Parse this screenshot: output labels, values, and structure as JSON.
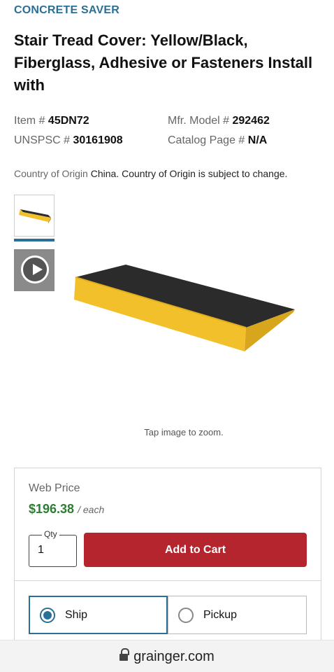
{
  "brand": "CONCRETE SAVER",
  "product": {
    "title": "Stair Tread Cover: Yellow/Black, Fiberglass, Adhesive or Fasteners Install with"
  },
  "specs": {
    "item_label": "Item #",
    "item_value": "45DN72",
    "mfr_label": "Mfr. Model #",
    "mfr_value": "292462",
    "unspsc_label": "UNSPSC #",
    "unspsc_value": "30161908",
    "catalog_label": "Catalog Page #",
    "catalog_value": "N/A"
  },
  "origin": {
    "label": "Country of Origin",
    "value": "China. Country of Origin is subject to change."
  },
  "gallery": {
    "zoom_hint": "Tap image to zoom.",
    "thumbnails": [
      "stair-tread-image",
      "play-video"
    ]
  },
  "buy": {
    "web_price_label": "Web Price",
    "price": "$196.38",
    "unit": "/ each",
    "qty_label": "Qty",
    "qty_value": "1",
    "add_to_cart": "Add to Cart",
    "fulfillment": {
      "ship_label": "Ship",
      "pickup_label": "Pickup",
      "selected": "Ship"
    }
  },
  "browser": {
    "url": "grainger.com"
  },
  "colors": {
    "brand_blue": "#2a6f97",
    "price_green": "#2e7d32",
    "cart_red": "#b5252e",
    "tread_yellow": "#f2c02b",
    "tread_black": "#2b2b2b"
  }
}
